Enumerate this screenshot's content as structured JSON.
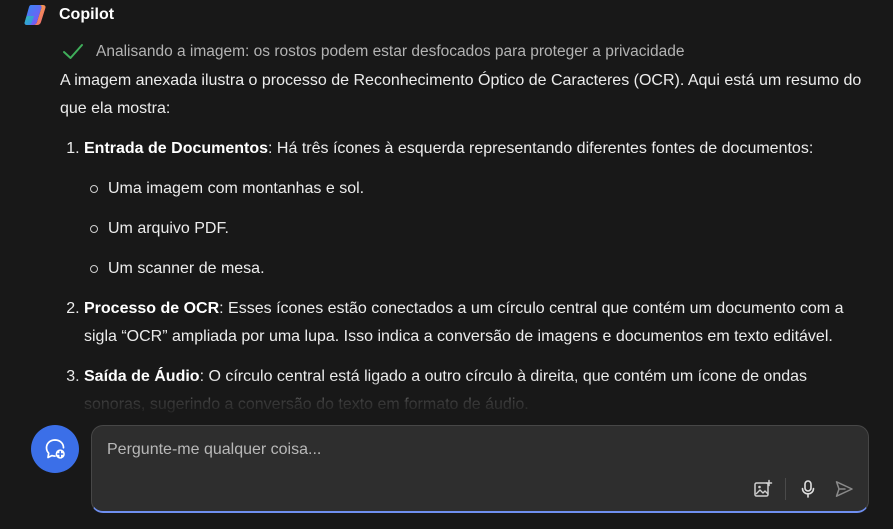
{
  "app": {
    "name": "Copilot",
    "logo_icon": "copilot-logo-icon"
  },
  "status": {
    "icon": "check-icon",
    "text": "Analisando a imagem: os rostos podem estar desfocados para proteger a privacidade"
  },
  "response": {
    "intro": "A imagem anexada ilustra o processo de Reconhecimento Óptico de Caracteres (OCR). Aqui está um resumo do que ela mostra:",
    "items": [
      {
        "title": "Entrada de Documentos",
        "text": ": Há três ícones à esquerda representando diferentes fontes de documentos:",
        "bullets": [
          "Uma imagem com montanhas e sol.",
          "Um arquivo PDF.",
          "Um scanner de mesa."
        ]
      },
      {
        "title": "Processo de OCR",
        "text": ": Esses ícones estão conectados a um círculo central que contém um documento com a sigla “OCR” ampliada por uma lupa. Isso indica a conversão de imagens e documentos em texto editável."
      },
      {
        "title": "Saída de Áudio",
        "text": ": O círculo central está ligado a outro círculo à direita, que contém um ícone de ondas sonoras, sugerindo a conversão do texto em formato de áudio."
      }
    ]
  },
  "composer": {
    "placeholder": "Pergunte-me qualquer coisa...",
    "value": "",
    "new_chat_icon": "new-chat-icon",
    "image_icon": "add-image-icon",
    "mic_icon": "microphone-icon",
    "send_icon": "send-icon"
  },
  "colors": {
    "background": "#181818",
    "accent": "#3b6fe8",
    "check": "#3fae5a",
    "composer_bg": "#2e2e2e"
  }
}
